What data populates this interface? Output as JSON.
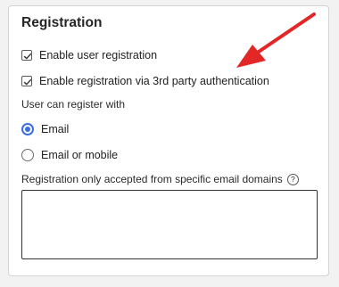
{
  "panel": {
    "title": "Registration"
  },
  "options": {
    "enable_user_registration": {
      "label": "Enable user registration",
      "checked": true
    },
    "enable_third_party": {
      "label": "Enable registration via 3rd party authentication",
      "checked": true
    }
  },
  "register_with": {
    "label": "User can register with",
    "choices": [
      {
        "label": "Email",
        "selected": true
      },
      {
        "label": "Email or mobile",
        "selected": false
      }
    ]
  },
  "domains": {
    "label": "Registration only accepted from specific email domains",
    "help_icon": "question-circle-icon",
    "value": ""
  },
  "colors": {
    "accent": "#3a6ee8",
    "arrow": "#e32626"
  }
}
